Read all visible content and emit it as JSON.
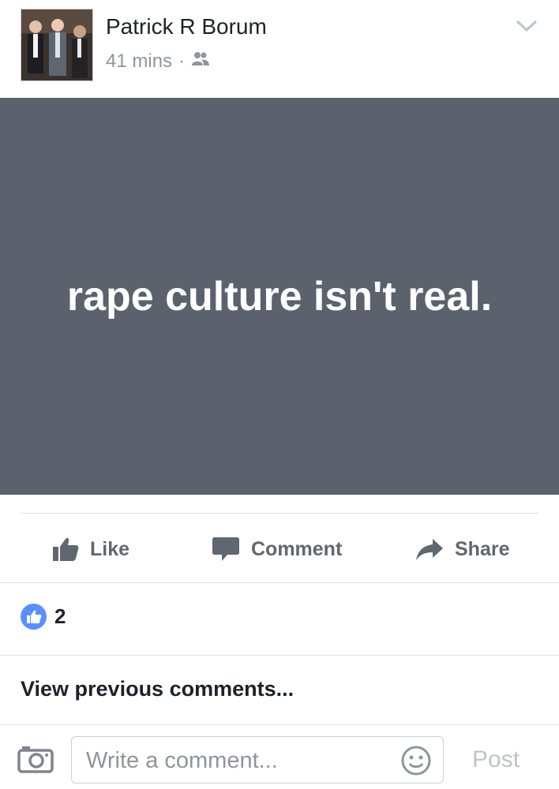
{
  "header": {
    "author_name": "Patrick R Borum",
    "time_ago": "41 mins",
    "separator": "·",
    "audience_icon": "friends-icon",
    "options_icon": "chevron-down-icon"
  },
  "post": {
    "text": "rape culture isn't real.",
    "background_color": "#5b626d",
    "text_color": "#ffffff"
  },
  "actions": {
    "like_label": "Like",
    "comment_label": "Comment",
    "share_label": "Share"
  },
  "reactions": {
    "count": "2",
    "icon": "thumbs-up-icon"
  },
  "comments": {
    "view_previous_label": "View previous comments..."
  },
  "composer": {
    "placeholder": "Write a comment...",
    "post_label": "Post",
    "camera_icon": "camera-icon",
    "emoji_icon": "smiley-icon"
  }
}
